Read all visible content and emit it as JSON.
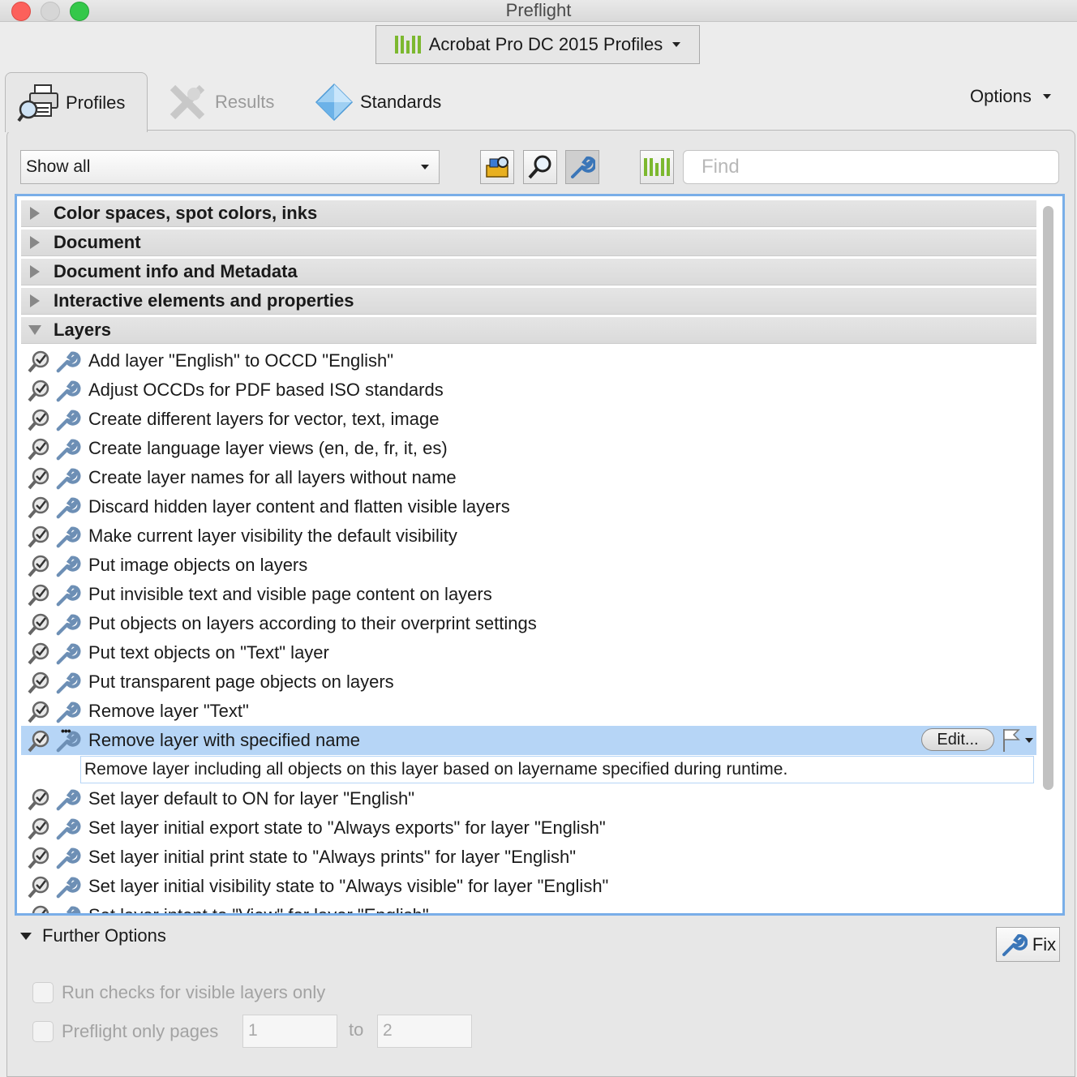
{
  "window": {
    "title": "Preflight"
  },
  "profile_set": {
    "label": "Acrobat Pro DC 2015 Profiles",
    "icon": "bars-icon"
  },
  "tabs": [
    {
      "label": "Profiles",
      "icon": "printer-magnifier-icon",
      "active": true
    },
    {
      "label": "Results",
      "icon": "wrench-cross-icon",
      "active": false
    },
    {
      "label": "Standards",
      "icon": "diamond-icon",
      "active": false
    }
  ],
  "options_label": "Options",
  "filter": {
    "selected": "Show all"
  },
  "search": {
    "placeholder": "Find"
  },
  "categories": [
    {
      "label": "Color spaces, spot colors, inks",
      "expanded": false
    },
    {
      "label": "Document",
      "expanded": false
    },
    {
      "label": "Document info and Metadata",
      "expanded": false
    },
    {
      "label": "Interactive elements and properties",
      "expanded": false
    },
    {
      "label": "Layers",
      "expanded": true
    }
  ],
  "fixups": [
    "Add layer \"English\" to OCCD \"English\"",
    "Adjust OCCDs for PDF based ISO standards",
    "Create different layers for vector, text, image",
    "Create language layer views (en, de, fr, it, es)",
    "Create layer names for all layers without name",
    "Discard hidden layer content and flatten visible layers",
    "Make current layer visibility the default visibility",
    "Put image objects on layers",
    "Put invisible text and visible page content on layers",
    "Put objects on layers according to their overprint settings",
    "Put text objects on \"Text\" layer",
    "Put transparent page objects on layers",
    "Remove layer \"Text\""
  ],
  "selected_fixup": {
    "label": "Remove layer with specified name",
    "description": "Remove layer including all objects on this layer based on layername specified during runtime.",
    "edit_label": "Edit..."
  },
  "fixups_after": [
    "Set layer default to ON for layer \"English\"",
    "Set layer initial export state to \"Always exports\" for layer \"English\"",
    "Set layer initial print state to \"Always prints\" for layer \"English\"",
    "Set layer initial visibility state to \"Always visible\" for layer \"English\"",
    "Set layer intent to \"View\" for layer \"English\""
  ],
  "further_options": {
    "label": "Further Options",
    "visible_layers_label": "Run checks for visible layers only",
    "pages_label": "Preflight only pages",
    "page_from": "1",
    "to_label": "to",
    "page_to": "2"
  },
  "fix_label": "Fix",
  "colors": {
    "accent_border": "#79aee8",
    "selection": "#b6d5f6",
    "brand_green": "#7cb82f"
  }
}
